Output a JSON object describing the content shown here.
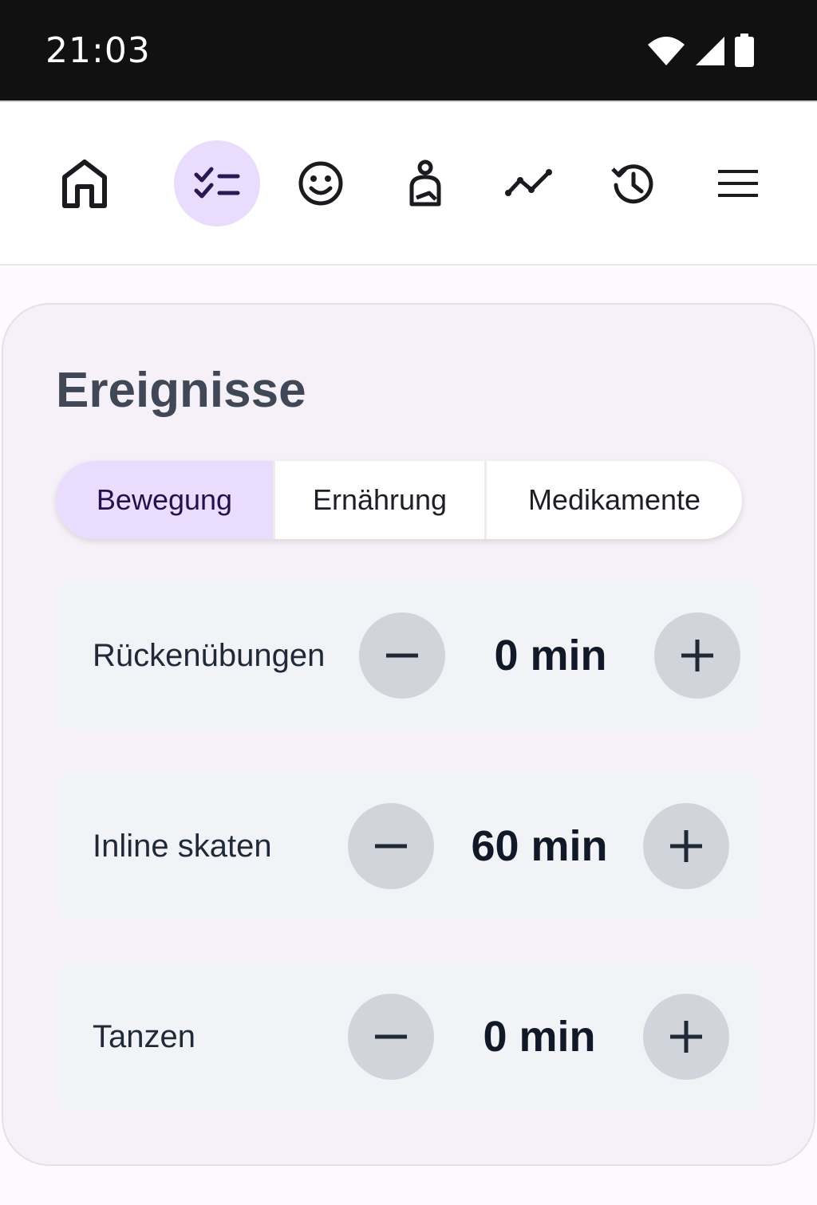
{
  "status_bar": {
    "time": "21:03",
    "icons": [
      "wifi-icon",
      "signal-icon",
      "battery-icon"
    ]
  },
  "nav": {
    "items": [
      {
        "name": "home",
        "icon": "home-icon",
        "active": false
      },
      {
        "name": "checklist",
        "icon": "checklist-icon",
        "active": true
      },
      {
        "name": "mood",
        "icon": "smiley-icon",
        "active": false
      },
      {
        "name": "body",
        "icon": "person-injury-icon",
        "active": false
      },
      {
        "name": "chart",
        "icon": "trend-line-icon",
        "active": false
      },
      {
        "name": "history",
        "icon": "history-icon",
        "active": false
      },
      {
        "name": "menu",
        "icon": "menu-icon",
        "active": false
      }
    ]
  },
  "events": {
    "title": "Ereignisse",
    "tabs": [
      {
        "label": "Bewegung",
        "selected": true
      },
      {
        "label": "Ernährung",
        "selected": false
      },
      {
        "label": "Medikamente",
        "selected": false
      }
    ],
    "items": [
      {
        "label": "Rückenübungen",
        "value": "0 min"
      },
      {
        "label": "Inline skaten",
        "value": "60 min"
      },
      {
        "label": "Tanzen",
        "value": "0 min"
      }
    ]
  },
  "colors": {
    "accent": "#eadcfc",
    "card_bg": "#f6f1f8",
    "row_bg": "#f2f3f6",
    "button_bg": "#d1d5db",
    "title": "#404756"
  }
}
